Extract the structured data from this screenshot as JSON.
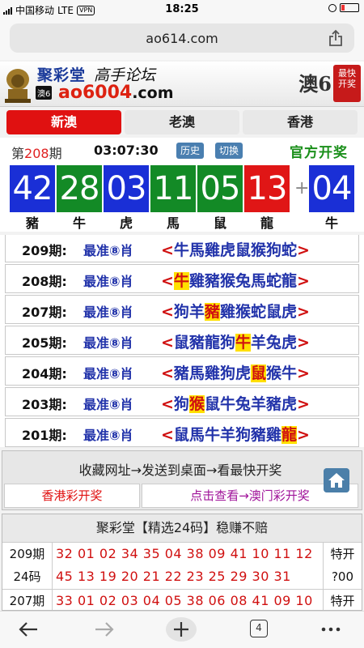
{
  "statusbar": {
    "carrier": "中国移动",
    "network": "LTE",
    "vpn": "VPN",
    "time": "18:25"
  },
  "browser": {
    "url": "ao614.com",
    "tab_count": "4"
  },
  "banner": {
    "brand": "聚彩堂",
    "slogan": "高手论坛",
    "tag": "澳6",
    "domain_main": "ao6004",
    "domain_tld": ".com",
    "right_text": "澳6",
    "stamp_line1": "最快",
    "stamp_line2": "开奖"
  },
  "tabs": [
    {
      "label": "新澳",
      "active": true
    },
    {
      "label": "老澳",
      "active": false
    },
    {
      "label": "香港",
      "active": false
    }
  ],
  "draw": {
    "issue_prefix": "第",
    "issue_number": "208",
    "issue_suffix": "期",
    "time": "03:07:30",
    "history_label": "历史",
    "switch_label": "切换",
    "official_label": "官方开奖"
  },
  "balls": [
    {
      "number": "42",
      "zodiac": "豬",
      "color": "blue"
    },
    {
      "number": "28",
      "zodiac": "牛",
      "color": "green"
    },
    {
      "number": "03",
      "zodiac": "虎",
      "color": "blue"
    },
    {
      "number": "11",
      "zodiac": "馬",
      "color": "green"
    },
    {
      "number": "05",
      "zodiac": "鼠",
      "color": "green"
    },
    {
      "number": "13",
      "zodiac": "龍",
      "color": "red"
    },
    {
      "number": "04",
      "zodiac": "牛",
      "color": "blue"
    }
  ],
  "plus_sign": "+",
  "predictions": [
    {
      "issue": "209期:",
      "label": "最准⑧肖",
      "picks": [
        "牛",
        "馬",
        "雞",
        "虎",
        "鼠",
        "猴",
        "狗",
        "蛇"
      ],
      "hit": -1
    },
    {
      "issue": "208期:",
      "label": "最准⑧肖",
      "picks": [
        "牛",
        "雞",
        "豬",
        "猴",
        "兔",
        "馬",
        "蛇",
        "龍"
      ],
      "hit": 0
    },
    {
      "issue": "207期:",
      "label": "最准⑧肖",
      "picks": [
        "狗",
        "羊",
        "豬",
        "雞",
        "猴",
        "蛇",
        "鼠",
        "虎"
      ],
      "hit": 2
    },
    {
      "issue": "205期:",
      "label": "最准⑧肖",
      "picks": [
        "鼠",
        "豬",
        "龍",
        "狗",
        "牛",
        "羊",
        "兔",
        "虎"
      ],
      "hit": 4
    },
    {
      "issue": "204期:",
      "label": "最准⑧肖",
      "picks": [
        "豬",
        "馬",
        "雞",
        "狗",
        "虎",
        "鼠",
        "猴",
        "牛"
      ],
      "hit": 5
    },
    {
      "issue": "203期:",
      "label": "最准⑧肖",
      "picks": [
        "狗",
        "猴",
        "鼠",
        "牛",
        "兔",
        "羊",
        "豬",
        "虎"
      ],
      "hit": 1
    },
    {
      "issue": "201期:",
      "label": "最准⑧肖",
      "picks": [
        "鼠",
        "馬",
        "牛",
        "羊",
        "狗",
        "豬",
        "雞",
        "龍"
      ],
      "hit": 7
    }
  ],
  "bookmark": {
    "text": "收藏网址→发送到桌面→看最快开奖",
    "left_link": "香港彩开奖",
    "right_link": "点击查看→澳门彩开奖"
  },
  "panel": {
    "title": "聚彩堂【精选24码】稳赚不赔",
    "rows": [
      {
        "issue": "209期",
        "subtitle": "24码",
        "line1": "32 01 02 34 35 04 38 09 41 10 11 12",
        "line2": "45 13 19 20 21 22 23 25 29 30 31",
        "special1": "特开",
        "special2": "?00"
      },
      {
        "issue": "207期",
        "subtitle": "",
        "line1": "33 01 02 03 04 05 38 06 08 41 09 10",
        "line2": "",
        "special1": "特开",
        "special2": ""
      }
    ]
  },
  "colors": {
    "accent_red": "#e01111",
    "ball_blue": "#1a2fd6",
    "ball_green": "#138a26",
    "ball_red": "#e01616",
    "official_green": "#1a8f1a",
    "hit_yellow": "#ffe000"
  },
  "icons": {
    "share": "share-icon",
    "back": "back-arrow-icon",
    "forward": "forward-arrow-icon",
    "new_tab": "plus-icon",
    "tabs": "tabs-icon",
    "more": "more-dots-icon",
    "home": "home-icon"
  }
}
